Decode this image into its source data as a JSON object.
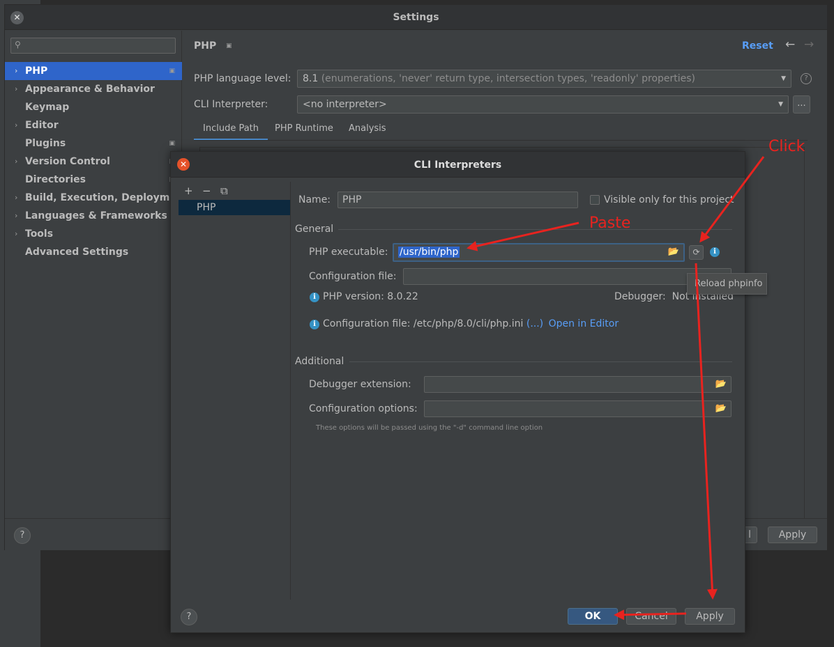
{
  "settings": {
    "title": "Settings",
    "search_placeholder": "",
    "tree": [
      {
        "label": "PHP",
        "expandable": true,
        "selected": true,
        "project_scoped": true
      },
      {
        "label": "Appearance & Behavior",
        "expandable": true
      },
      {
        "label": "Keymap",
        "expandable": false
      },
      {
        "label": "Editor",
        "expandable": true
      },
      {
        "label": "Plugins",
        "expandable": false,
        "project_scoped": true
      },
      {
        "label": "Version Control",
        "expandable": true,
        "project_scoped": true
      },
      {
        "label": "Directories",
        "expandable": false,
        "project_scoped": true
      },
      {
        "label": "Build, Execution, Deployment",
        "expandable": true
      },
      {
        "label": "Languages & Frameworks",
        "expandable": true
      },
      {
        "label": "Tools",
        "expandable": true
      },
      {
        "label": "Advanced Settings",
        "expandable": false
      }
    ],
    "page": {
      "breadcrumb": "PHP",
      "reset_label": "Reset",
      "language_level_label": "PHP language level:",
      "language_level_value": "8.1",
      "language_level_detail": "(enumerations, 'never' return type, intersection types, 'readonly' properties)",
      "cli_interpreter_label": "CLI Interpreter:",
      "cli_interpreter_value": "<no interpreter>",
      "ellipsis": "...",
      "tabs": [
        "Include Path",
        "PHP Runtime",
        "Analysis"
      ],
      "active_tab": "Include Path"
    },
    "footer": {
      "help": "?",
      "cancel_partial": "l",
      "apply": "Apply"
    }
  },
  "dialog": {
    "title": "CLI Interpreters",
    "tools": [
      "+",
      "−",
      "⧉"
    ],
    "interpreters": [
      "PHP"
    ],
    "name_label": "Name:",
    "name_value": "PHP",
    "visible_only_label": "Visible only for this project",
    "general_label": "General",
    "php_exec_label": "PHP executable:",
    "php_exec_value": "/usr/bin/php",
    "config_file_label": "Configuration file:",
    "config_file_value": "",
    "php_version_text": "PHP version: 8.0.22",
    "debugger_text": "Debugger:  Not installed",
    "config_file_info": "Configuration file: /etc/php/8.0/cli/php.ini",
    "config_more_link": "(...)",
    "open_editor_link": "Open in Editor",
    "additional_label": "Additional",
    "debugger_ext_label": "Debugger extension:",
    "config_options_label": "Configuration options:",
    "options_note": "These options will be passed using the \"-d\" command line option",
    "tooltip": "Reload phpinfo",
    "footer": {
      "help": "?",
      "ok": "OK",
      "cancel": "Cancel",
      "apply": "Apply"
    }
  },
  "annotations": {
    "click": "Click",
    "paste": "Paste",
    "color": "#e8231f"
  },
  "colors": {
    "accent": "#2f65ca",
    "link": "#589df6",
    "close_red": "#e5522a",
    "annotation_red": "#e8231f"
  }
}
